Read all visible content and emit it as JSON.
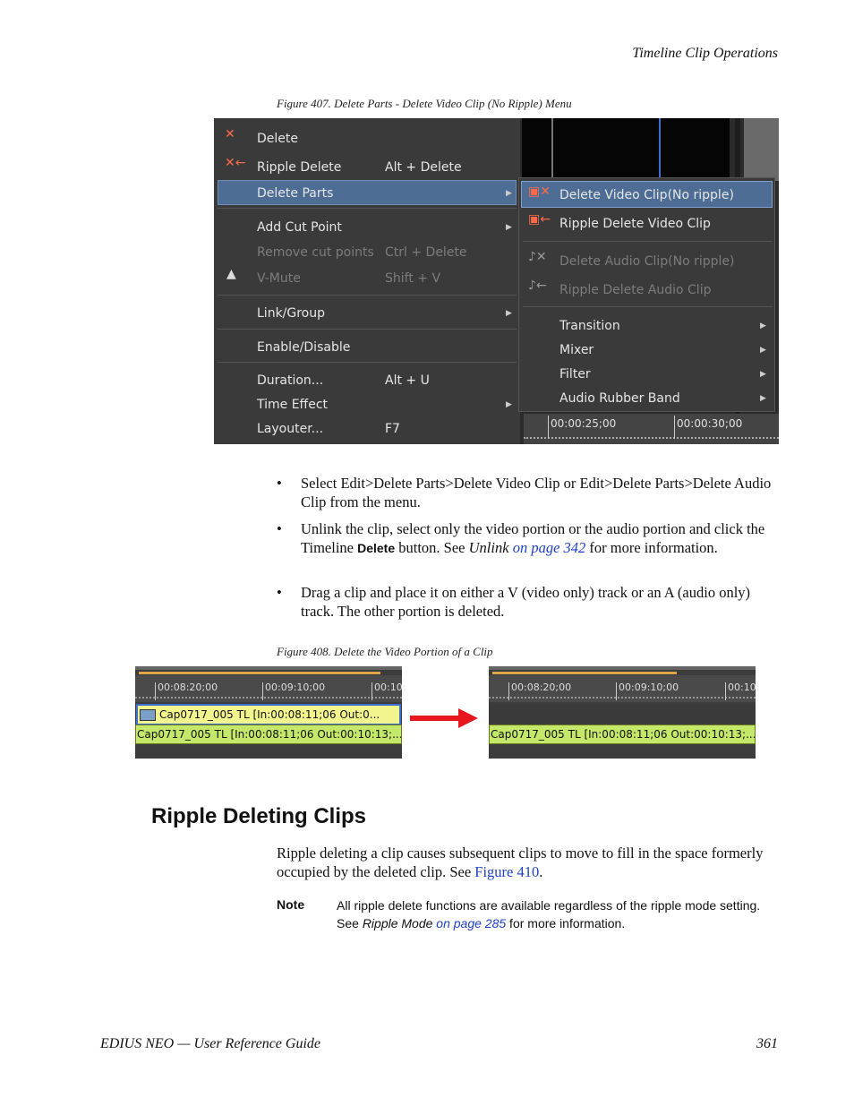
{
  "header": {
    "section": "Timeline Clip Operations"
  },
  "figure407": {
    "caption": "Figure 407.  Delete Parts - Delete Video Clip (No Ripple) Menu",
    "main_menu": [
      {
        "label": "Delete",
        "shortcut": "",
        "disabled": false,
        "submenu": false,
        "icon": "delete-icon"
      },
      {
        "label": "Ripple Delete",
        "shortcut": "Alt + Delete",
        "disabled": false,
        "submenu": false,
        "icon": "ripple-delete-icon"
      },
      {
        "label": "Delete Parts",
        "shortcut": "",
        "disabled": false,
        "submenu": true,
        "highlighted": true
      },
      {
        "label": "Add Cut Point",
        "shortcut": "",
        "disabled": false,
        "submenu": true
      },
      {
        "label": "Remove cut points",
        "shortcut": "Ctrl + Delete",
        "disabled": true,
        "submenu": false
      },
      {
        "label": "V-Mute",
        "shortcut": "Shift + V",
        "disabled": true,
        "submenu": false,
        "icon": "v-mute-icon"
      },
      {
        "label": "Link/Group",
        "shortcut": "",
        "disabled": false,
        "submenu": true
      },
      {
        "label": "Enable/Disable",
        "shortcut": "",
        "disabled": false,
        "submenu": false
      },
      {
        "label": "Duration...",
        "shortcut": "Alt + U",
        "disabled": false,
        "submenu": false
      },
      {
        "label": "Time Effect",
        "shortcut": "",
        "disabled": false,
        "submenu": true
      },
      {
        "label": "Layouter...",
        "shortcut": "F7",
        "disabled": false,
        "submenu": false
      }
    ],
    "sub_menu": [
      {
        "label": "Delete Video Clip(No ripple)",
        "disabled": false,
        "highlighted": true
      },
      {
        "label": "Ripple Delete Video Clip",
        "disabled": false
      },
      {
        "label": "Delete Audio Clip(No ripple)",
        "disabled": true
      },
      {
        "label": "Ripple Delete Audio Clip",
        "disabled": true
      },
      {
        "label": "Transition",
        "disabled": false,
        "submenu": true
      },
      {
        "label": "Mixer",
        "disabled": false,
        "submenu": true
      },
      {
        "label": "Filter",
        "disabled": false,
        "submenu": true
      },
      {
        "label": "Audio Rubber Band",
        "disabled": false,
        "submenu": true
      }
    ],
    "ruler": [
      "00:00:25;00",
      "00:00:30;00"
    ]
  },
  "bullets": [
    {
      "text": "Select Edit>Delete Parts>Delete Video Clip or Edit>Delete Parts>Delete Audio Clip from the menu."
    },
    {
      "pre": "Unlink the clip, select only the video portion or the audio portion and click the Timeline ",
      "bold": "Delete",
      "mid": " button. See ",
      "ital": "Unlink",
      "link": " on page 342",
      "post": " for more information."
    },
    {
      "text": "Drag a clip and place it on either a V (video only) track or an A (audio only) track. The other portion is deleted."
    }
  ],
  "figure408": {
    "caption": "Figure 408.  Delete the Video Portion of a Clip",
    "ticks": [
      "00:08:20;00",
      "00:09:10;00",
      "00:10:"
    ],
    "before_video": "Cap0717_005   TL  [In:00:08:11;06 Out:0...",
    "before_audio": "Cap0717_005  TL  [In:00:08:11;06 Out:00:10:13;...",
    "after_audio": "Cap0717_005  TL  [In:00:08:11;06 Out:00:10:13;..."
  },
  "section": {
    "heading": "Ripple Deleting Clips",
    "para_pre": "Ripple deleting a clip causes subsequent clips to move to fill in the space formerly occupied by the deleted clip. See ",
    "para_link": "Figure 410",
    "para_post": "."
  },
  "note": {
    "label": "Note",
    "line1": "All ripple delete functions are available regardless of the ripple mode setting.",
    "see": "See ",
    "ital": "Ripple Mode",
    "link": " on page 285",
    "post": " for more information."
  },
  "footer": {
    "title": "EDIUS NEO  —  User Reference Guide",
    "page": "361"
  },
  "colors": {
    "menu_bg": "#3a3a3a",
    "highlight": "#4d6d94",
    "link": "#2040c8",
    "arrow": "#e8161e",
    "clip_video": "#f2f58e",
    "clip_audio": "#c4e86a"
  }
}
